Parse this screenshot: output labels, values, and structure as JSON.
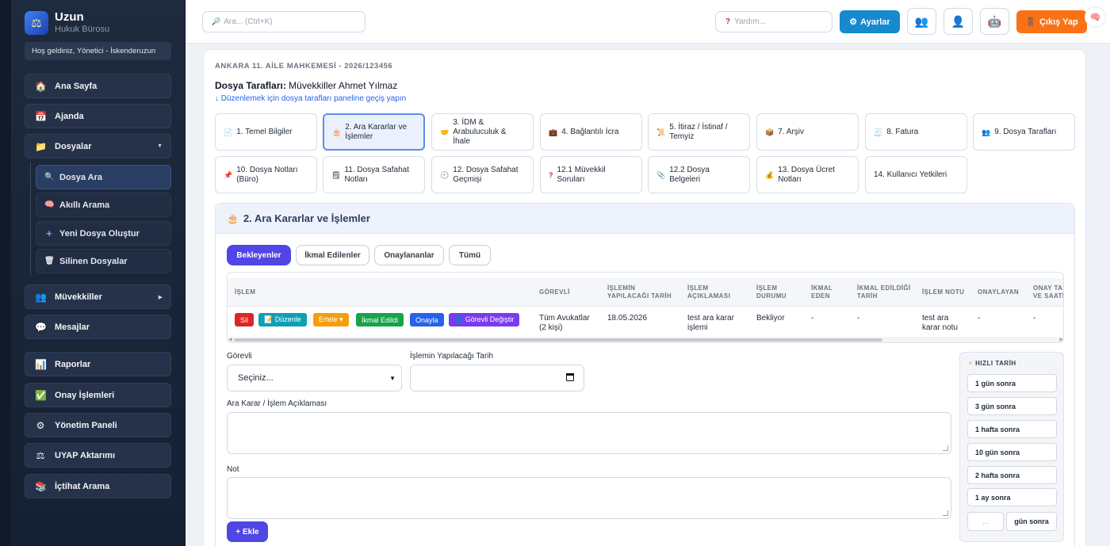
{
  "sidebar": {
    "brand_title": "Uzun",
    "brand_sub": "Hukuk Bürosu",
    "welcome": "Hoş geldiniz, Yönetici - İskenderuzun",
    "items": [
      {
        "label": "Ana Sayfa",
        "icon": "house-icon"
      },
      {
        "label": "Ajanda",
        "icon": "calendar-icon"
      },
      {
        "label": "Dosyalar",
        "icon": "folder-icon"
      },
      {
        "label": "Müvekkiller",
        "icon": "users-icon"
      },
      {
        "label": "Mesajlar",
        "icon": "chat-icon"
      },
      {
        "label": "Raporlar",
        "icon": "bar-chart-icon"
      },
      {
        "label": "Onay İşlemleri",
        "icon": "check-box-icon"
      },
      {
        "label": "Yönetim Paneli",
        "icon": "gear-icon"
      },
      {
        "label": "UYAP Aktarımı",
        "icon": "scales-icon"
      },
      {
        "label": "İçtihat Arama",
        "icon": "books-icon"
      }
    ],
    "sub_items": [
      {
        "label": "Dosya Ara",
        "icon": "search-icon"
      },
      {
        "label": "Akıllı Arama",
        "icon": "brain-icon"
      },
      {
        "label": "Yeni Dosya Oluştur",
        "icon": "plus-icon"
      },
      {
        "label": "Silinen Dosyalar",
        "icon": "trash-icon"
      }
    ]
  },
  "topbar": {
    "search_placeholder": "Ara... (Ctrl+K)",
    "help_placeholder": "Yardım...",
    "settings_label": "Ayarlar",
    "logout_label": "Çıkış Yap"
  },
  "case": {
    "title": "ANKARA 11. AİLE MAHKEMESİ - 2026/123456",
    "parties_label": "Dosya Tarafları:",
    "parties_value": "Müvekkiller Ahmet Yılmaz",
    "parties_link": "↓ Düzenlemek için dosya tarafları paneline geçiş yapın"
  },
  "tabs": [
    {
      "label": "1. Temel Bilgiler",
      "icon": "document-icon"
    },
    {
      "label": "2. Ara Kararlar ve İşlemler",
      "icon": "cake-icon"
    },
    {
      "label": "3. İDM & Arabuluculuk & İhale",
      "icon": "handshake-icon"
    },
    {
      "label": "4. Bağlantılı İcra",
      "icon": "briefcase-icon"
    },
    {
      "label": "5. İtiraz / İstinaf / Temyiz",
      "icon": "scroll-icon"
    },
    {
      "label": "7. Arşiv",
      "icon": "box-icon"
    },
    {
      "label": "8. Fatura",
      "icon": "receipt-icon"
    },
    {
      "label": "9. Dosya Tarafları",
      "icon": "people-icon"
    },
    {
      "label": "10. Dosya Notları (Büro)",
      "icon": "pin-icon"
    },
    {
      "label": "11. Dosya Safahat Notları",
      "icon": "notepad-icon"
    },
    {
      "label": "12. Dosya Safahat Geçmişi",
      "icon": "clock-icon"
    },
    {
      "label": "12.1 Müvekkil Soruları",
      "icon": "question-icon"
    },
    {
      "label": "12.2 Dosya Belgeleri",
      "icon": "clip-icon"
    },
    {
      "label": "13. Dosya Ücret Notları",
      "icon": "money-bag-icon"
    },
    {
      "label": "14. Kullanıcı Yetkileri",
      "icon": ""
    }
  ],
  "section": {
    "title": "2. Ara Kararlar ve İşlemler",
    "filters": [
      "Bekleyenler",
      "İkmal Edilenler",
      "Onaylananlar",
      "Tümü"
    ],
    "columns": [
      "İŞLEM",
      "GÖREVLİ",
      "İŞLEMİN YAPILACAĞI TARİH",
      "İŞLEM AÇIKLAMASI",
      "İŞLEM DURUMU",
      "İKMAL EDEN",
      "İKMAL EDİLDİĞİ TARİH",
      "İŞLEM NOTU",
      "ONAYLAYAN",
      "ONAY TARİHİ VE SAATİ"
    ],
    "row": {
      "actions": [
        {
          "label": "Sil",
          "color": "#dc2626"
        },
        {
          "label": "📝 Düzenle",
          "color": "#0e9fb5"
        },
        {
          "label": "Ertele ▾",
          "color": "#f59e0b"
        },
        {
          "label": "İkmal Edildi",
          "color": "#16a34a"
        },
        {
          "label": "Onayla",
          "color": "#2563eb"
        },
        {
          "label": "👤 Görevli Değiştir",
          "color": "#7c3aed"
        }
      ],
      "gorevli": "Tüm Avukatlar (2 kişi)",
      "tarih": "18.05.2026",
      "aciklama": "test ara karar işlemi",
      "durum": "Bekliyor",
      "ikmal_eden": "-",
      "ikmal_tarih": "-",
      "not": "test ara karar notu",
      "onaylayan": "-",
      "onay_tarih": "-"
    },
    "form": {
      "gorevli_label": "Görevli",
      "gorevli_value": "Seçiniz...",
      "tarih_label": "İşlemin Yapılacağı Tarih",
      "aciklama_label": "Ara Karar / İşlem Açıklaması",
      "not_label": "Not",
      "add_label": "+ Ekle"
    },
    "quick": {
      "title": "HIZLI TARİH",
      "options": [
        "1 gün sonra",
        "3 gün sonra",
        "1 hafta sonra",
        "10 gün sonra",
        "2 hafta sonra",
        "1 ay sonra"
      ],
      "custom_placeholder": "...",
      "custom_button": "gün sonra"
    }
  }
}
